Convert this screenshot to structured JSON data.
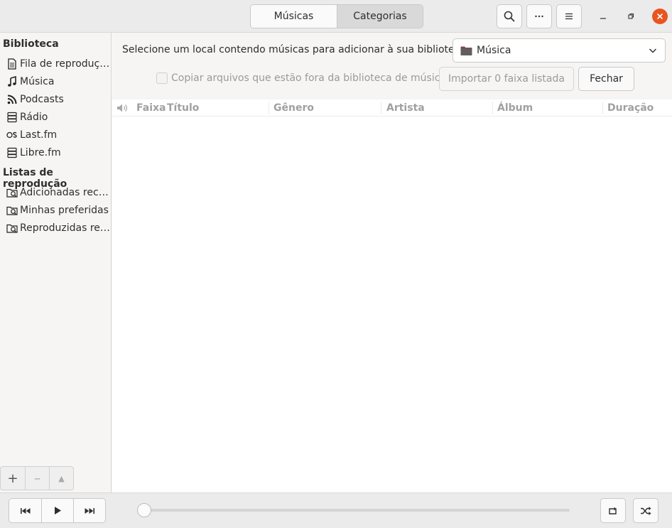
{
  "header": {
    "tabs": [
      {
        "label": "Músicas",
        "active": false
      },
      {
        "label": "Categorias",
        "active": true
      }
    ],
    "icons": {
      "search": "search-icon",
      "more": "more-horizontal-icon",
      "menu": "hamburger-menu-icon",
      "minimize": "minimize-icon",
      "restore": "restore-icon",
      "close": "close-icon"
    },
    "close_color": "#e95420"
  },
  "sidebar": {
    "library_heading": "Biblioteca",
    "library_items": [
      {
        "label": "Fila de reprodução",
        "icon": "document-icon"
      },
      {
        "label": "Música",
        "icon": "music-note-icon"
      },
      {
        "label": "Podcasts",
        "icon": "rss-icon"
      },
      {
        "label": "Rádio",
        "icon": "radio-server-icon"
      },
      {
        "label": "Last.fm",
        "icon": "lastfm-icon"
      },
      {
        "label": "Libre.fm",
        "icon": "server-icon"
      }
    ],
    "playlists_heading": "Listas de reprodução",
    "playlist_items": [
      {
        "label": "Adicionadas recentemente",
        "icon": "smart-playlist-icon"
      },
      {
        "label": "Minhas preferidas",
        "icon": "smart-playlist-icon"
      },
      {
        "label": "Reproduzidas recentemente",
        "icon": "smart-playlist-icon"
      }
    ],
    "tools": {
      "add": "+",
      "remove": "–",
      "eject": "▲"
    }
  },
  "import": {
    "prompt": "Selecione um local contendo músicas para adicionar à sua biblioteca:",
    "folder": "Música",
    "copy_label": "Copiar arquivos que estão fora da biblioteca de música",
    "copy_checked": false,
    "import_button": "Importar 0 faixa listada",
    "close_button": "Fechar"
  },
  "tracklist": {
    "columns": [
      "Faixa",
      "Título",
      "Gênero",
      "Artista",
      "Álbum",
      "Duração"
    ],
    "rows": []
  },
  "player": {
    "icons": [
      "previous-icon",
      "play-icon",
      "next-icon",
      "repeat-icon",
      "shuffle-icon"
    ],
    "position_fraction": 0
  }
}
